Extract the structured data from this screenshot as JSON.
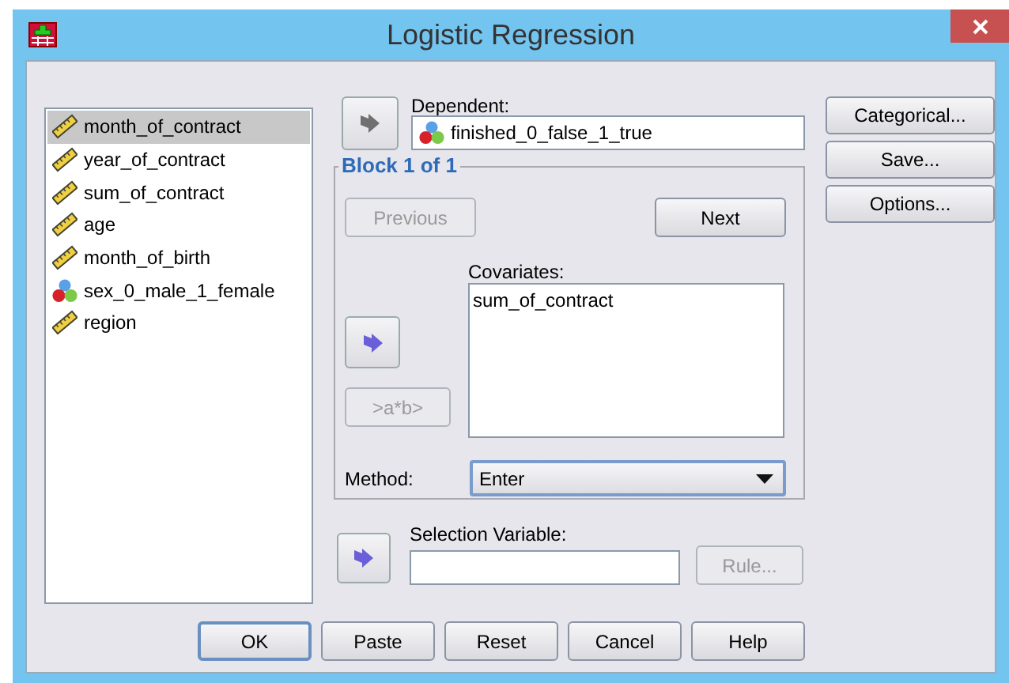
{
  "window": {
    "title": "Logistic Regression"
  },
  "variables": [
    {
      "name": "month_of_contract",
      "kind": "scale",
      "selected": true
    },
    {
      "name": "year_of_contract",
      "kind": "scale",
      "selected": false
    },
    {
      "name": "sum_of_contract",
      "kind": "scale",
      "selected": false
    },
    {
      "name": "age",
      "kind": "scale",
      "selected": false
    },
    {
      "name": "month_of_birth",
      "kind": "scale",
      "selected": false
    },
    {
      "name": "sex_0_male_1_female",
      "kind": "nominal",
      "selected": false
    },
    {
      "name": "region",
      "kind": "scale",
      "selected": false
    }
  ],
  "dependent": {
    "label": "Dependent:",
    "arrow_disabled": true,
    "value": {
      "name": "finished_0_false_1_true",
      "kind": "nominal"
    }
  },
  "block": {
    "title": "Block 1 of 1",
    "previous": {
      "label": "Previous",
      "disabled": true
    },
    "next": {
      "label": "Next",
      "disabled": false
    },
    "covariates_label": "Covariates:",
    "covariates": [
      "sum_of_contract"
    ],
    "arrow_disabled": false,
    "interaction": {
      "label": ">a*b>",
      "disabled": true
    },
    "method_label": "Method:",
    "method": "Enter"
  },
  "selection": {
    "label": "Selection Variable:",
    "arrow_disabled": false,
    "rule": {
      "label": "Rule...",
      "disabled": true
    }
  },
  "side_buttons": [
    {
      "label": "Categorical..."
    },
    {
      "label": "Save..."
    },
    {
      "label": "Options..."
    }
  ],
  "buttons": [
    {
      "label": "OK",
      "default": true
    },
    {
      "label": "Paste",
      "default": false
    },
    {
      "label": "Reset",
      "default": false
    },
    {
      "label": "Cancel",
      "default": false
    },
    {
      "label": "Help",
      "default": false
    }
  ]
}
